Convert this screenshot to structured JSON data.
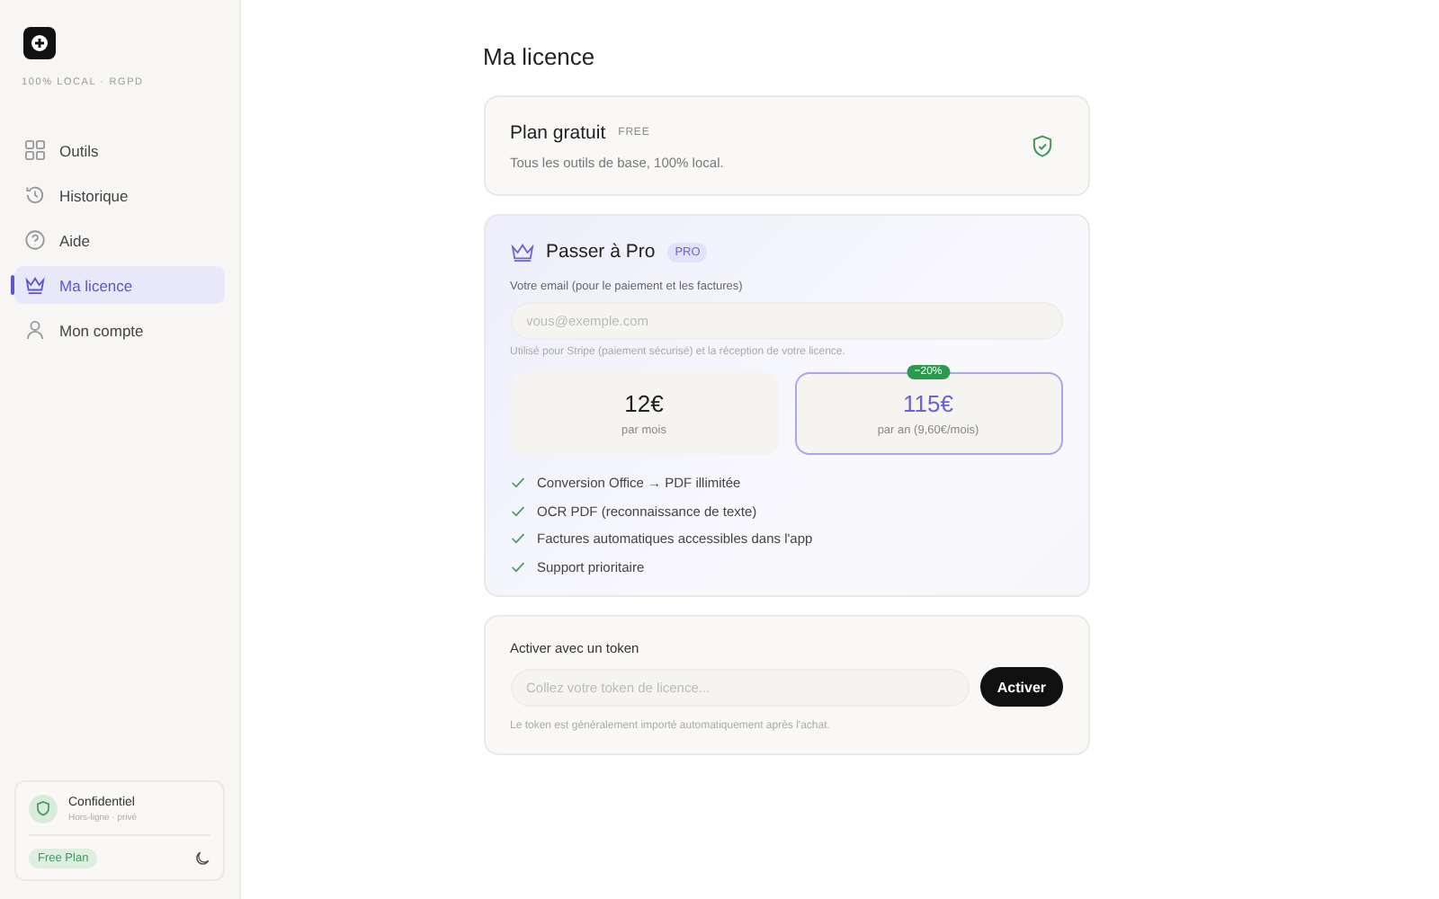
{
  "sidebar": {
    "tagline": "100% LOCAL · RGPD",
    "items": [
      {
        "label": "Outils",
        "selected": false
      },
      {
        "label": "Historique",
        "selected": false
      },
      {
        "label": "Aide",
        "selected": false
      },
      {
        "label": "Ma licence",
        "selected": true
      },
      {
        "label": "Mon compte",
        "selected": false
      }
    ],
    "status": {
      "title": "Confidentiel",
      "subtitle": "Hors-ligne · privé",
      "plan_badge": "Free Plan"
    }
  },
  "page_title": "Ma licence",
  "free_plan": {
    "title": "Plan gratuit",
    "badge": "FREE",
    "description": "Tous les outils de base, 100% local."
  },
  "pro": {
    "title": "Passer à Pro",
    "badge": "PRO",
    "email_label": "Votre email (pour le paiement et les factures)",
    "email_placeholder": "vous@exemple.com",
    "email_hint": "Utilisé pour Stripe (paiement sécurisé) et la réception de votre licence.",
    "plans": [
      {
        "price": "12€",
        "period": "par mois",
        "selected": false
      },
      {
        "price": "115€",
        "period": "par an (9,60€/mois)",
        "discount": "−20%",
        "selected": true
      }
    ],
    "features": [
      "Conversion Office → PDF illimitée",
      "OCR PDF (reconnaissance de texte)",
      "Factures automatiques accessibles dans l'app",
      "Support prioritaire"
    ]
  },
  "token": {
    "title": "Activer avec un token",
    "placeholder": "Collez votre token de licence...",
    "button": "Activer",
    "hint": "Le token est généralement importé automatiquement après l'achat."
  }
}
